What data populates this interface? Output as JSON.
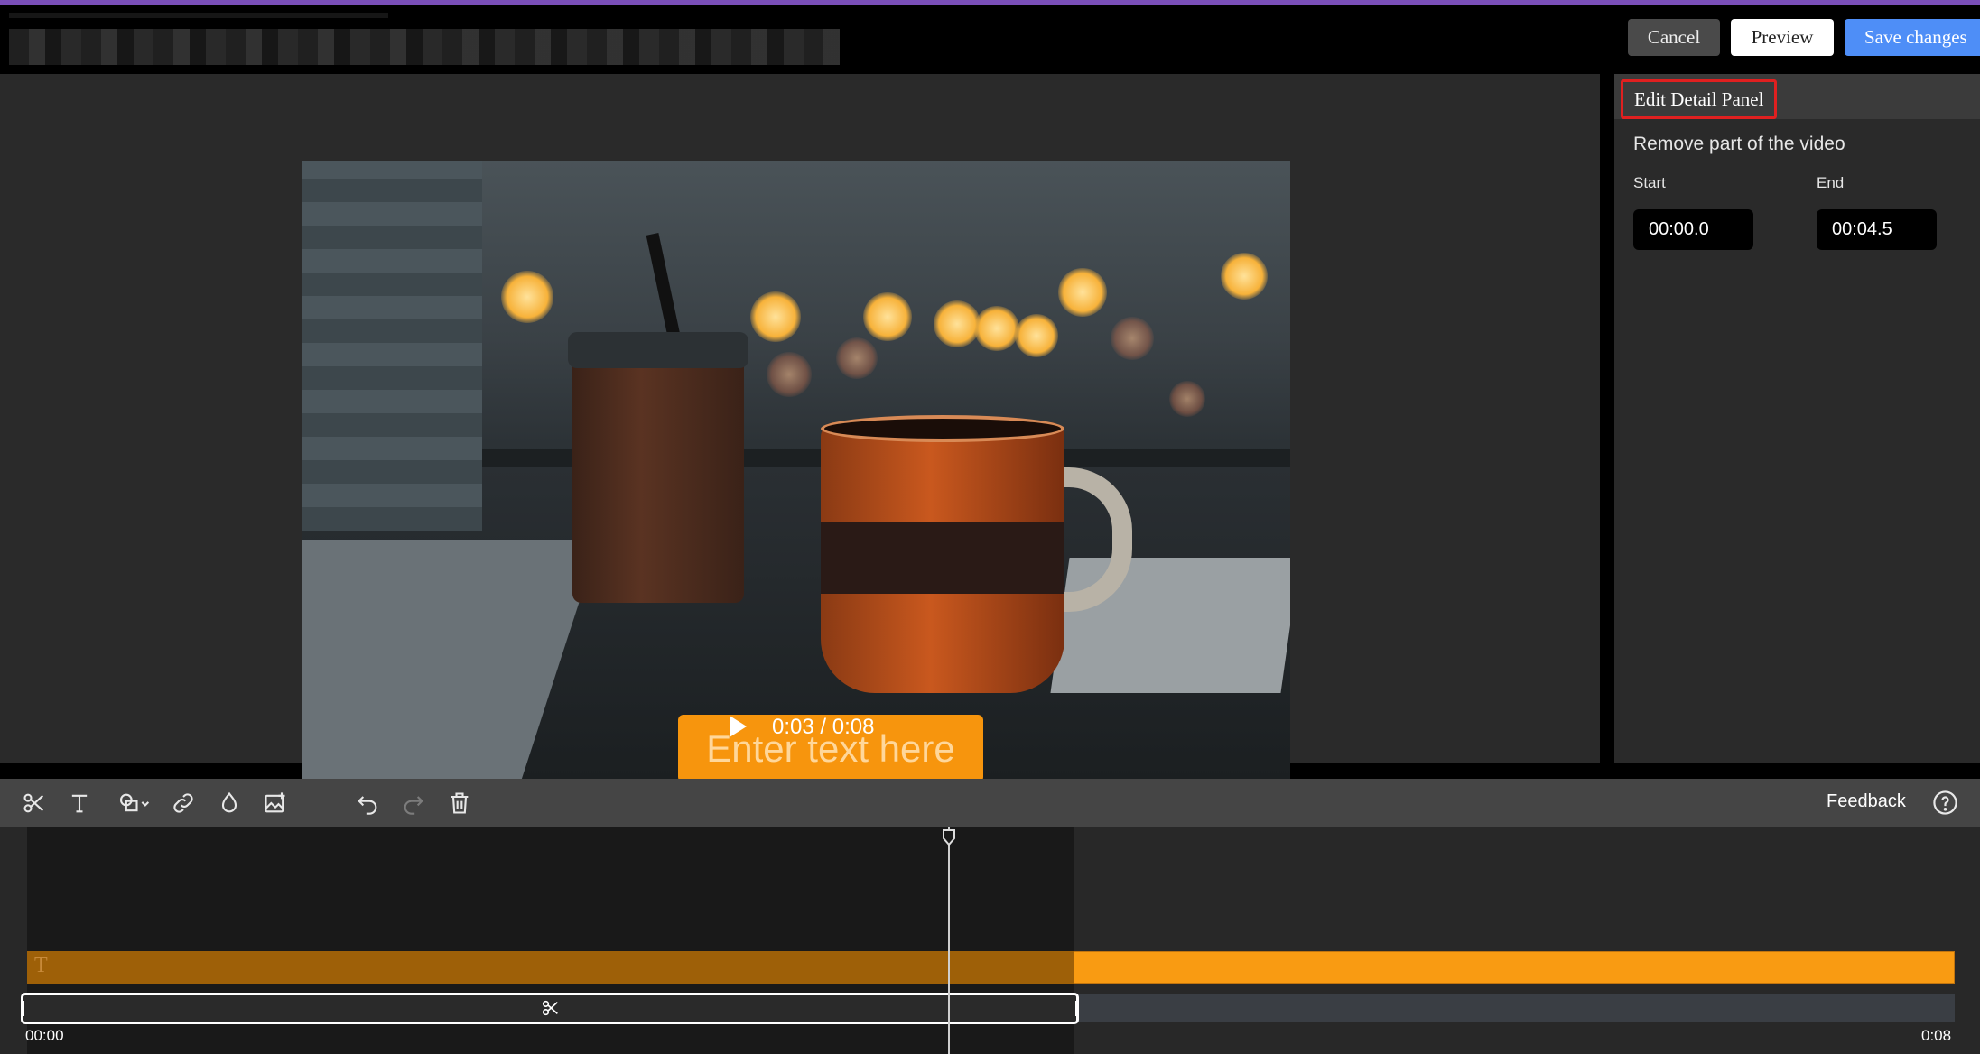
{
  "header": {
    "cancel_label": "Cancel",
    "preview_label": "Preview",
    "save_label": "Save changes"
  },
  "video": {
    "overlay_placeholder": "Enter text here",
    "current_time": "0:03",
    "duration": "0:08",
    "time_readout": "0:03 / 0:08"
  },
  "panel": {
    "title": "Edit Detail Panel",
    "description": "Remove part of the video",
    "start_label": "Start",
    "start_value": "00:00.0",
    "end_label": "End",
    "end_value": "00:04.5"
  },
  "toolbar": {
    "tools": [
      "scissors-icon",
      "text-icon",
      "shapes-icon",
      "link-icon",
      "drop-icon",
      "image-icon",
      "undo-icon",
      "redo-icon",
      "trash-icon"
    ],
    "feedback_label": "Feedback"
  },
  "timeline": {
    "start_time": "00:00",
    "end_time": "0:08",
    "text_track_glyph": "T"
  },
  "colors": {
    "accent_purple": "#7a4fb8",
    "save_blue": "#4e8ef7",
    "text_orange": "#f7950d",
    "highlight_red": "#e02020"
  }
}
